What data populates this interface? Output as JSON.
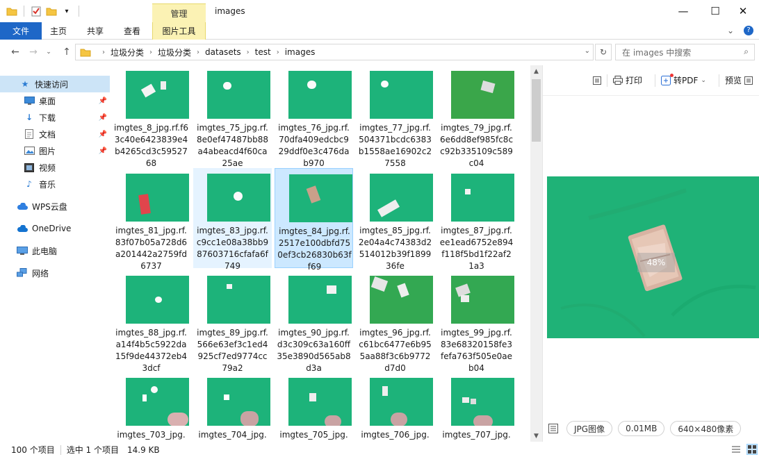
{
  "window": {
    "title": "images",
    "contextual_tab": "管理",
    "controls": {
      "minimize": "—",
      "maximize": "☐",
      "close": "✕"
    }
  },
  "ribbon": {
    "tabs": [
      "文件",
      "主页",
      "共享",
      "查看",
      "图片工具"
    ],
    "file_color": "#1e67c7",
    "expand": "⌄",
    "help": "?"
  },
  "address": {
    "path": [
      "垃圾分类",
      "垃圾分类",
      "datasets",
      "test",
      "images"
    ],
    "search_placeholder": "在 images 中搜索"
  },
  "nav": {
    "quick_access": "快速访问",
    "items": [
      {
        "label": "桌面",
        "icon": "desktop-icon",
        "pinned": true
      },
      {
        "label": "下载",
        "icon": "download-icon",
        "pinned": true
      },
      {
        "label": "文档",
        "icon": "document-icon",
        "pinned": true
      },
      {
        "label": "图片",
        "icon": "pictures-icon",
        "pinned": true
      },
      {
        "label": "视频",
        "icon": "video-icon",
        "pinned": false
      },
      {
        "label": "音乐",
        "icon": "music-icon",
        "pinned": false
      }
    ],
    "wps": "WPS云盘",
    "onedrive": "OneDrive",
    "thispc": "此电脑",
    "network": "网络"
  },
  "files": [
    {
      "name": "imgtes_8_jpg.rf.f63c40e6423839e4b4265cd3c5952768"
    },
    {
      "name": "imgtes_75_jpg.rf.8e0ef47487bb88a4abeacd4f60ca25ae"
    },
    {
      "name": "imgtes_76_jpg.rf.70dfa409edcbc929ddf0e3c476dab970"
    },
    {
      "name": "imgtes_77_jpg.rf.504371bcdc6383b1558ae16902c27558"
    },
    {
      "name": "imgtes_79_jpg.rf.6e6dd8ef985fc8cc92b335109c589c04"
    },
    {
      "name": "imgtes_81_jpg.rf.83f07b05a728d6a201442a2759fd6737"
    },
    {
      "name": "imgtes_83_jpg.rf.c9cc1e08a38bb987603716cfafa6f749"
    },
    {
      "name": "imgtes_84_jpg.rf.2517e100dbfd750ef3cb26830b63ff69"
    },
    {
      "name": "imgtes_85_jpg.rf.2e04a4c74383d2514012b39f189936fe"
    },
    {
      "name": "imgtes_87_jpg.rf.ee1ead6752e894f118f5bd1f22af21a3"
    },
    {
      "name": "imgtes_88_jpg.rf.a14f4b5c5922da15f9de44372eb43dcf"
    },
    {
      "name": "imgtes_89_jpg.rf.566e63ef3c1ed4925cf7ed9774cc79a2"
    },
    {
      "name": "imgtes_90_jpg.rf.d3c309c63a160ff35e3890d565ab8d3a"
    },
    {
      "name": "imgtes_96_jpg.rf.c61bc6477e6b955aa88f3c6b9772d7d0"
    },
    {
      "name": "imgtes_99_jpg.rf.83e68320158fe3fefa763f505e0aeb04"
    },
    {
      "name": "imgtes_703_jpg."
    },
    {
      "name": "imgtes_704_jpg."
    },
    {
      "name": "imgtes_705_jpg."
    },
    {
      "name": "imgtes_706_jpg."
    },
    {
      "name": "imgtes_707_jpg."
    }
  ],
  "preview": {
    "print": "打印",
    "to_pdf": "转PDF",
    "preview_label": "预览",
    "zoom": "48%",
    "file_type": "JPG图像",
    "file_size": "0.01MB",
    "dimensions": "640×480像素"
  },
  "status": {
    "count": "100 个项目",
    "selection": "选中 1 个项目",
    "size": "14.9 KB"
  }
}
